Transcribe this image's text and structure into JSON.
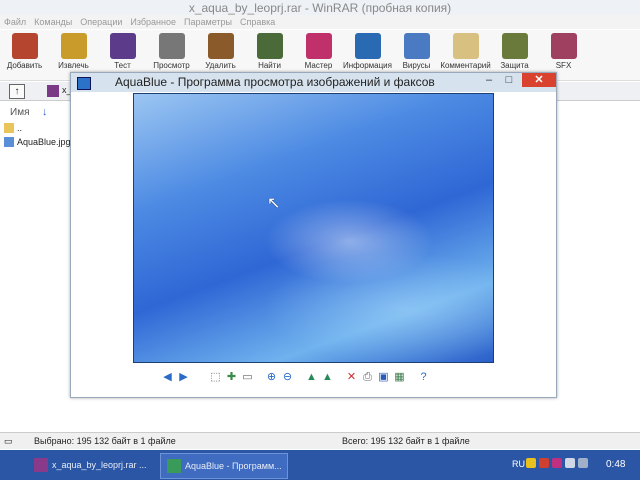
{
  "winrar": {
    "title": "x_aqua_by_leoprj.rar - WinRAR (пробная копия)",
    "menu": [
      "Файл",
      "Команды",
      "Операции",
      "Избранное",
      "Параметры",
      "Справка"
    ],
    "toolbar": [
      {
        "label": "Добавить",
        "icon": "add-archive-icon",
        "color": "#b5452f"
      },
      {
        "label": "Извлечь",
        "icon": "extract-icon",
        "color": "#c99b2a"
      },
      {
        "label": "Тест",
        "icon": "test-icon",
        "color": "#5b3b8a"
      },
      {
        "label": "Просмотр",
        "icon": "view-icon",
        "color": "#777"
      },
      {
        "label": "Удалить",
        "icon": "delete-icon",
        "color": "#8a5a2a"
      },
      {
        "label": "Найти",
        "icon": "find-icon",
        "color": "#4a6a3a"
      },
      {
        "label": "Мастер",
        "icon": "wizard-icon",
        "color": "#c0306a"
      },
      {
        "label": "Информация",
        "icon": "info-icon",
        "color": "#2a6ab2"
      },
      {
        "label": "Вирусы",
        "icon": "virus-icon",
        "color": "#4a7ac2"
      },
      {
        "label": "Комментарий",
        "icon": "comment-icon",
        "color": "#d8c080"
      },
      {
        "label": "Защита",
        "icon": "protect-icon",
        "color": "#6a7a3a"
      },
      {
        "label": "SFX",
        "icon": "sfx-icon",
        "color": "#a04060"
      }
    ],
    "address": "x_",
    "column_name": "Имя",
    "files": [
      {
        "name": "..",
        "type": "folder"
      },
      {
        "name": "AquaBlue.jpg",
        "type": "image"
      }
    ],
    "status_left": "Выбрано: 195 132 байт в 1 файле",
    "status_right": "Всего: 195 132 байт в 1 файле"
  },
  "viewer": {
    "title": "AquaBlue - Программа просмотра изображений и факсов",
    "toolbar_icons": [
      "previous-icon",
      "next-icon",
      "best-fit-icon",
      "actual-size-icon",
      "slideshow-icon",
      "zoom-in-icon",
      "zoom-out-icon",
      "rotate-cw-icon",
      "rotate-ccw-icon",
      "delete-icon",
      "print-icon",
      "save-icon",
      "edit-icon",
      "help-icon"
    ]
  },
  "taskbar": {
    "tasks": [
      {
        "label": "x_aqua_by_leoprj.rar ..."
      },
      {
        "label": "AquaBlue - Программ..."
      }
    ],
    "lang": "RU",
    "clock": "0:48"
  },
  "colors": {
    "taskbar": "#2b56a5",
    "accent": "#2a73c9",
    "close": "#d9422f"
  }
}
